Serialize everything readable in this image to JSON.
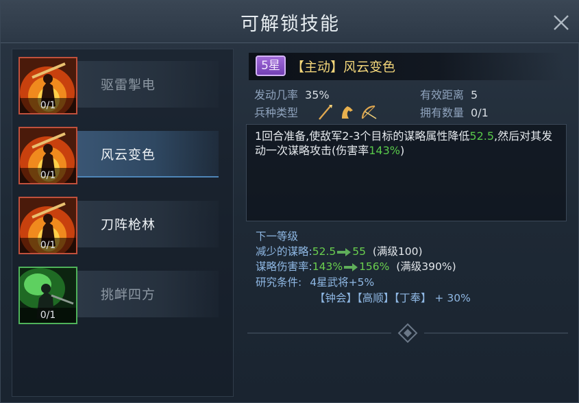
{
  "window": {
    "title": "可解锁技能"
  },
  "skills": [
    {
      "name": "驱雷掣电",
      "count": "0/1",
      "icon": "flame-warrior-icon",
      "frame": "red"
    },
    {
      "name": "风云变色",
      "count": "0/1",
      "icon": "flame-warrior-icon",
      "frame": "red"
    },
    {
      "name": "刀阵枪林",
      "count": "0/1",
      "icon": "flame-warrior-icon",
      "frame": "red"
    },
    {
      "name": "挑衅四方",
      "count": "0/1",
      "icon": "green-warrior-icon",
      "frame": "green"
    }
  ],
  "detail": {
    "star": "5星",
    "title": "【主动】风云变色",
    "trigger_label": "发动几率",
    "trigger_value": "35%",
    "range_label": "有效距离",
    "range_value": "5",
    "troop_label": "兵种类型",
    "troop_icons": [
      "spear-icon",
      "cavalry-icon",
      "bow-icon"
    ],
    "owned_label": "拥有数量",
    "owned_value": "0/1",
    "desc_a": "1回合准备,使敌军2-3个目标的谋略属性降低",
    "desc_b": "52.5",
    "desc_c": ",然后对其发动一次谋略攻击(伤害率",
    "desc_d": "143%",
    "desc_e": ")"
  },
  "next_level": {
    "heading": "下一等级",
    "row1_label": "减少的谋略:",
    "row1_from": "52.5",
    "row1_to": "55",
    "row1_max": "(满级100)",
    "row2_label": "谋略伤害率:",
    "row2_from": "143%",
    "row2_to": "156%",
    "row2_max": "(满级390%)",
    "research_label": "研究条件:",
    "research_value": "4星武将+5%",
    "generals": "【钟会】【高顺】【丁奉】 + 30%"
  },
  "colors": {
    "star_purple": "#8a52c6",
    "gold_title": "#f3d67a",
    "highlight_green": "#58c84a",
    "label_blue": "#8fb8e4"
  }
}
